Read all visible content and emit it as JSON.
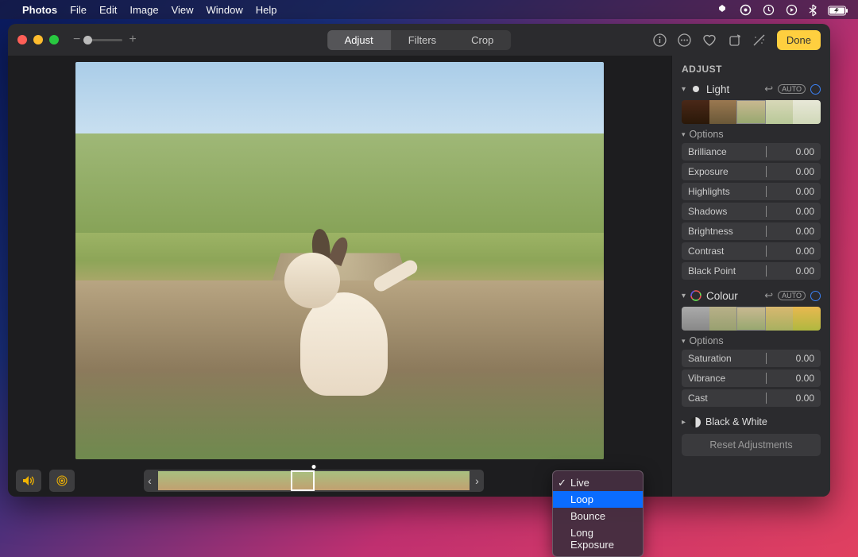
{
  "menubar": {
    "app": "Photos",
    "items": [
      "File",
      "Edit",
      "Image",
      "View",
      "Window",
      "Help"
    ]
  },
  "toolbar": {
    "tabs": {
      "adjust": "Adjust",
      "filters": "Filters",
      "crop": "Crop"
    },
    "done": "Done"
  },
  "dropdown": {
    "items": [
      {
        "label": "Live",
        "checked": true,
        "selected": false
      },
      {
        "label": "Loop",
        "checked": false,
        "selected": true
      },
      {
        "label": "Bounce",
        "checked": false,
        "selected": false
      },
      {
        "label": "Long Exposure",
        "checked": false,
        "selected": false
      }
    ]
  },
  "sidebar": {
    "heading": "ADJUST",
    "light": {
      "title": "Light",
      "auto": "AUTO",
      "options_label": "Options",
      "sliders": [
        {
          "label": "Brilliance",
          "value": "0.00"
        },
        {
          "label": "Exposure",
          "value": "0.00"
        },
        {
          "label": "Highlights",
          "value": "0.00"
        },
        {
          "label": "Shadows",
          "value": "0.00"
        },
        {
          "label": "Brightness",
          "value": "0.00"
        },
        {
          "label": "Contrast",
          "value": "0.00"
        },
        {
          "label": "Black Point",
          "value": "0.00"
        }
      ]
    },
    "colour": {
      "title": "Colour",
      "auto": "AUTO",
      "options_label": "Options",
      "sliders": [
        {
          "label": "Saturation",
          "value": "0.00"
        },
        {
          "label": "Vibrance",
          "value": "0.00"
        },
        {
          "label": "Cast",
          "value": "0.00"
        }
      ]
    },
    "bw": {
      "title": "Black & White"
    },
    "reset": "Reset Adjustments"
  }
}
